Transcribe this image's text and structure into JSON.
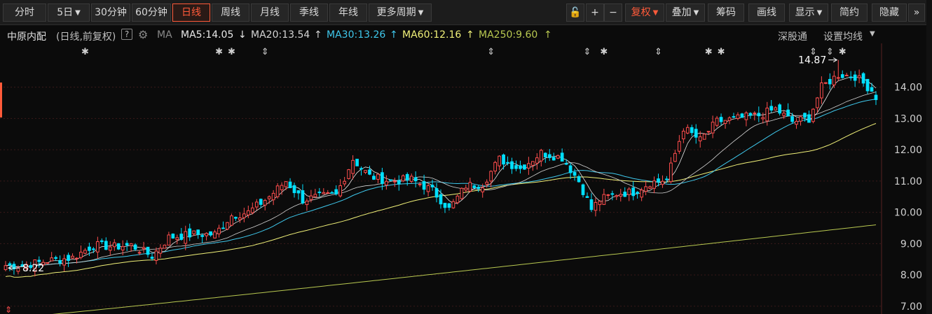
{
  "toolbar": {
    "tabs": [
      {
        "label": "分时",
        "active": false
      },
      {
        "label": "5日",
        "dropdown": true,
        "active": false
      },
      {
        "label": "30分钟",
        "active": false
      },
      {
        "label": "60分钟",
        "active": false
      },
      {
        "label": "日线",
        "active": true
      },
      {
        "label": "周线",
        "active": false
      },
      {
        "label": "月线",
        "active": false
      },
      {
        "label": "季线",
        "active": false
      },
      {
        "label": "年线",
        "active": false
      },
      {
        "label": "更多周期",
        "dropdown": true,
        "active": false
      }
    ],
    "tools": [
      {
        "label": "🔓",
        "icon": "unlock-icon"
      },
      {
        "label": "+",
        "icon": "zoom-in-icon"
      },
      {
        "label": "−",
        "icon": "zoom-out-icon"
      },
      {
        "label": "复权",
        "dropdown": true,
        "red": true
      },
      {
        "label": "叠加",
        "dropdown": true
      },
      {
        "label": "筹码"
      },
      {
        "label": "画线"
      },
      {
        "label": "显示",
        "dropdown": true
      },
      {
        "label": "简约"
      },
      {
        "label": "隐藏"
      },
      {
        "label": "»",
        "icon": "double-chevron-right-icon"
      }
    ]
  },
  "info": {
    "stock_name": "中原内配",
    "period_label": "(日线,前复权)",
    "help": "?",
    "ma_label": "MA",
    "ma5": "MA5:14.05",
    "ma5_arrow": "↓",
    "ma20": "MA20:13.54",
    "ma20_arrow": "↑",
    "ma30": "MA30:13.26",
    "ma30_arrow": "↑",
    "ma60": "MA60:12.16",
    "ma60_arrow": "↑",
    "ma250": "MA250:9.60",
    "ma250_arrow": "↑",
    "exchange_link": "深股通",
    "settings_link": "设置均线"
  },
  "colors": {
    "up": "#ff4d4d",
    "down": "#00e0ff",
    "ma5": "#e8e8e8",
    "ma20": "#d4d4d4",
    "ma30": "#3fc8ec",
    "ma60": "#f0f078",
    "ma250": "#b8c850",
    "accent": "#ff5a3a",
    "grid": "#3a1a1a"
  },
  "chart_data": {
    "type": "candlestick",
    "ylim": [
      6.75,
      15.4
    ],
    "y_ticks": [
      "14.00",
      "13.00",
      "12.00",
      "11.00",
      "10.00",
      "9.00",
      "8.00",
      "7.00"
    ],
    "y_tick_values": [
      14,
      13,
      12,
      11,
      10,
      9,
      8,
      7
    ],
    "annotations": {
      "high_label": "14.87",
      "high_value": 14.87,
      "low_label": "8.22",
      "low_value": 8.22
    },
    "event_markers": [
      {
        "index": 19,
        "symbol": "✱"
      },
      {
        "index": 51,
        "symbol": "✱"
      },
      {
        "index": 54,
        "symbol": "✱"
      },
      {
        "index": 62,
        "symbol": "⇕"
      },
      {
        "index": 116,
        "symbol": "⇕"
      },
      {
        "index": 139,
        "symbol": "⇕"
      },
      {
        "index": 143,
        "symbol": "✱"
      },
      {
        "index": 156,
        "symbol": "⇕"
      },
      {
        "index": 168,
        "symbol": "✱"
      },
      {
        "index": 171,
        "symbol": "✱"
      },
      {
        "index": 193,
        "symbol": "⇕"
      },
      {
        "index": 197,
        "symbol": "⇕"
      },
      {
        "index": 200,
        "symbol": "✱"
      }
    ],
    "anchors": [
      [
        0,
        8.3
      ],
      [
        4,
        8.3
      ],
      [
        10,
        8.45
      ],
      [
        16,
        8.55
      ],
      [
        21,
        8.95
      ],
      [
        26,
        8.9
      ],
      [
        30,
        8.95
      ],
      [
        35,
        8.6
      ],
      [
        39,
        9.2
      ],
      [
        45,
        9.3
      ],
      [
        50,
        9.3
      ],
      [
        54,
        9.9
      ],
      [
        58,
        10.0
      ],
      [
        63,
        10.5
      ],
      [
        67,
        11.0
      ],
      [
        71,
        10.4
      ],
      [
        75,
        10.5
      ],
      [
        79,
        10.55
      ],
      [
        83,
        11.7
      ],
      [
        87,
        11.15
      ],
      [
        92,
        11.0
      ],
      [
        97,
        11.05
      ],
      [
        102,
        10.7
      ],
      [
        106,
        10.1
      ],
      [
        110,
        10.85
      ],
      [
        114,
        10.9
      ],
      [
        118,
        11.7
      ],
      [
        123,
        11.4
      ],
      [
        128,
        11.9
      ],
      [
        133,
        11.75
      ],
      [
        137,
        11.0
      ],
      [
        140,
        10.1
      ],
      [
        142,
        10.4
      ],
      [
        146,
        10.6
      ],
      [
        150,
        10.65
      ],
      [
        154,
        10.95
      ],
      [
        158,
        11.05
      ],
      [
        162,
        12.7
      ],
      [
        166,
        12.3
      ],
      [
        170,
        12.9
      ],
      [
        175,
        13.0
      ],
      [
        180,
        13.1
      ],
      [
        184,
        13.3
      ],
      [
        188,
        12.9
      ],
      [
        192,
        13.0
      ],
      [
        195,
        14.0
      ],
      [
        199,
        14.4
      ],
      [
        203,
        14.35
      ],
      [
        207,
        13.9
      ],
      [
        208,
        13.6
      ]
    ],
    "ma250_range": [
      6.6,
      9.6
    ]
  }
}
